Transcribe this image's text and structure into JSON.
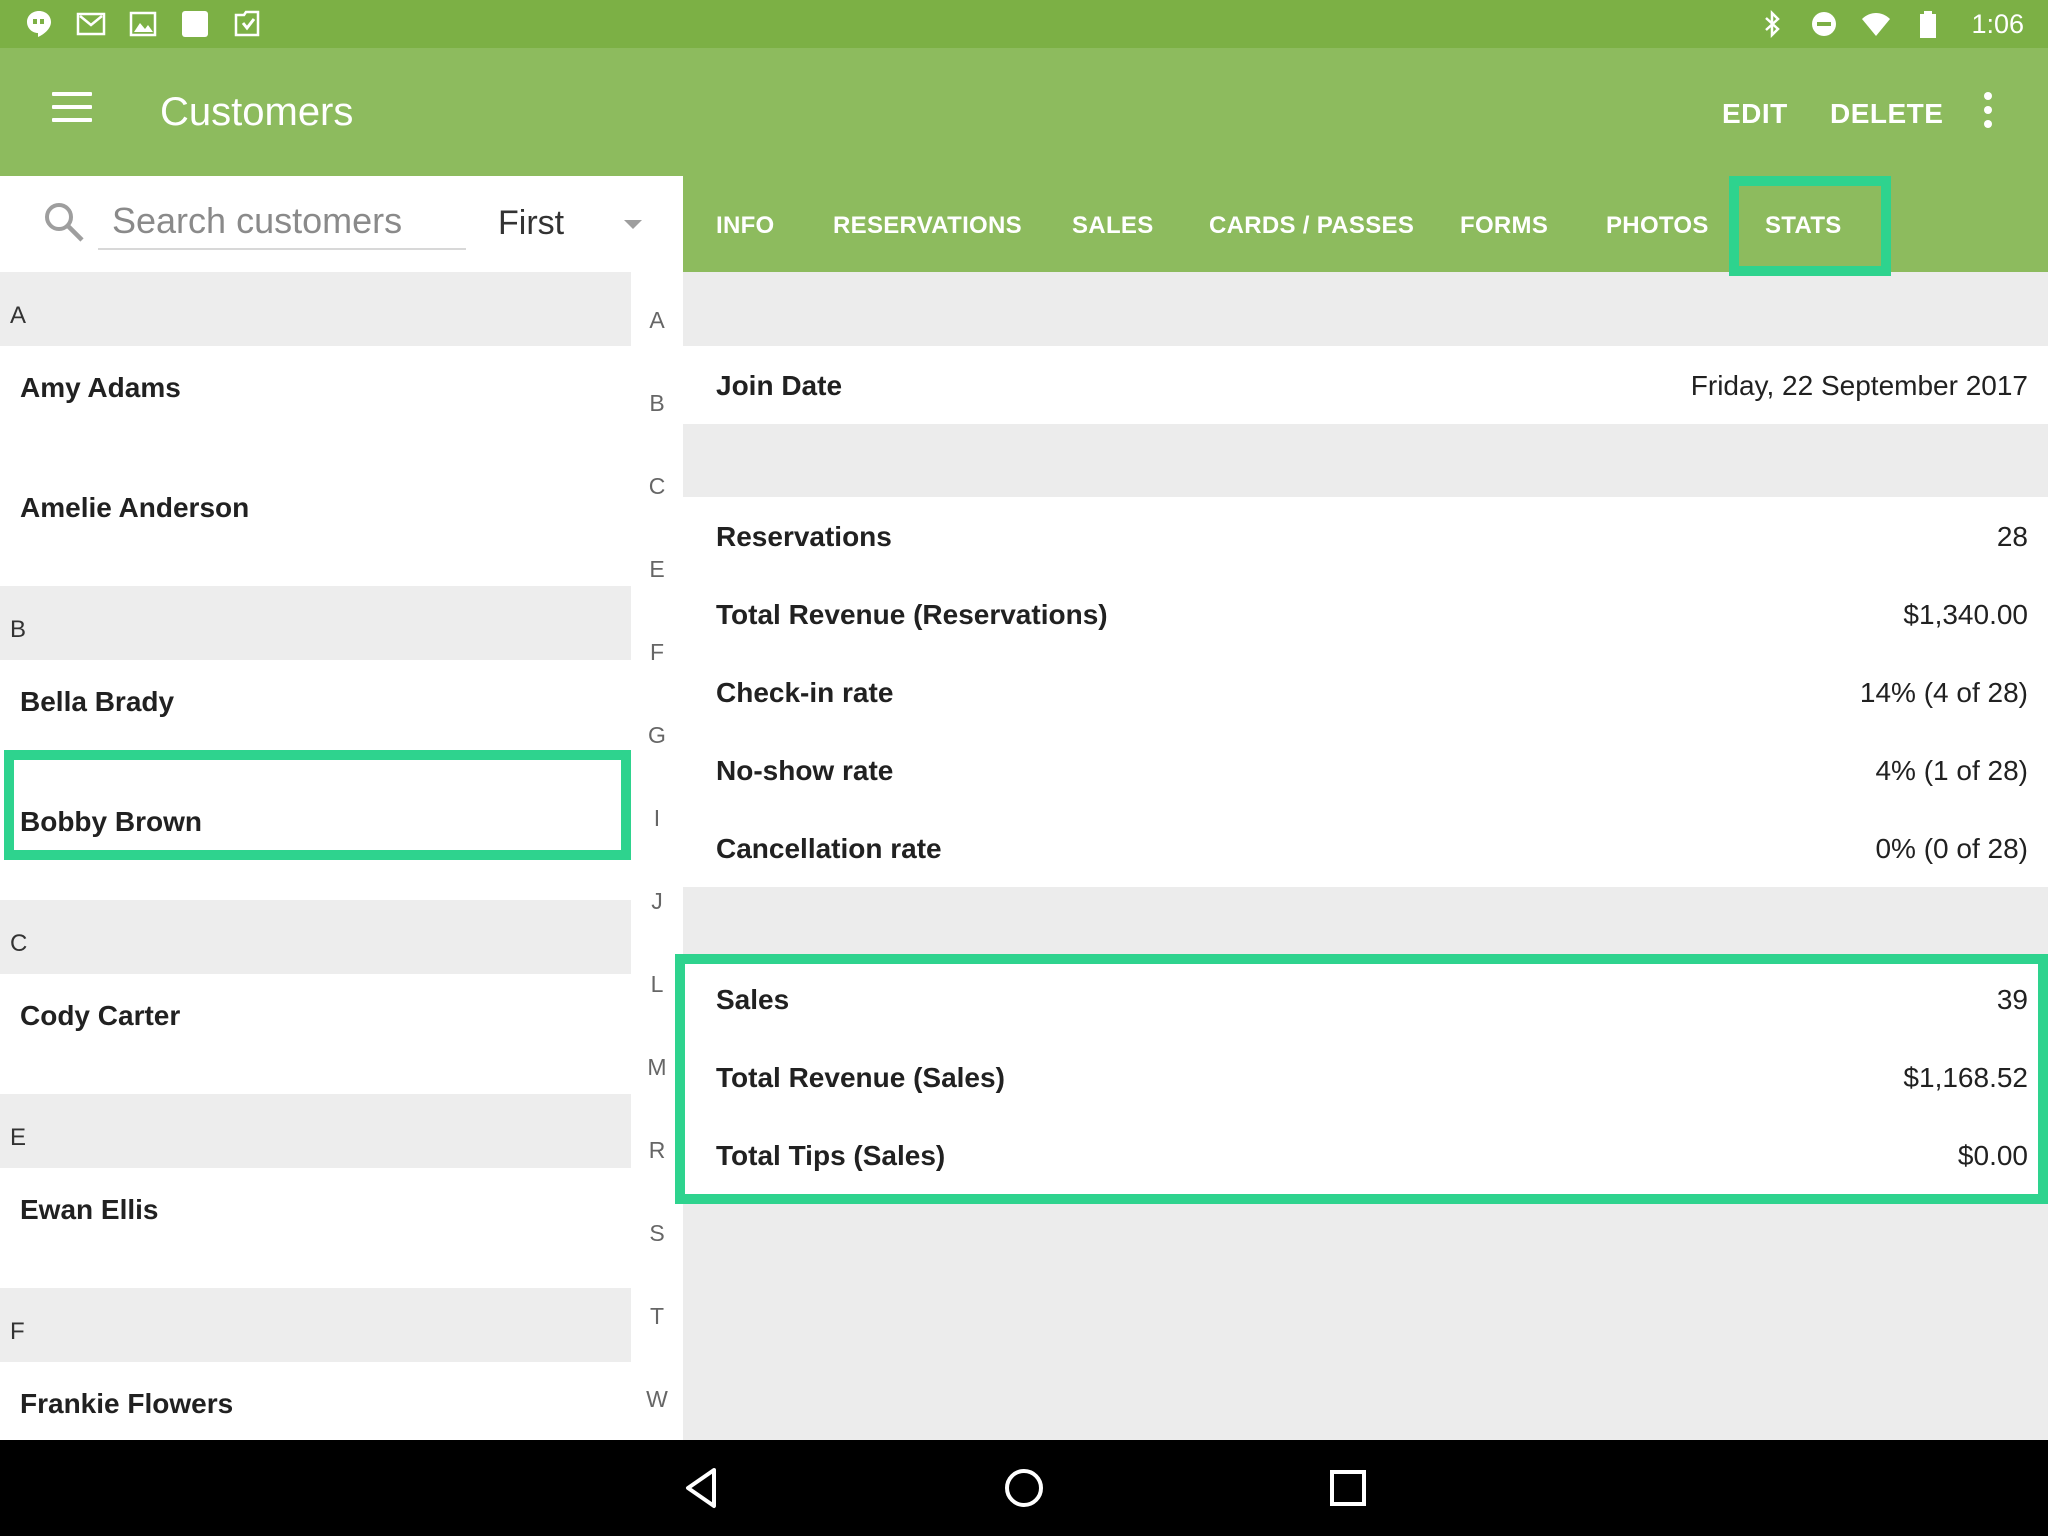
{
  "status_bar": {
    "time": "1:06",
    "left_icons": [
      "hangouts-icon",
      "gmail-icon",
      "gallery-icon",
      "square-app-icon",
      "play-store-icon"
    ],
    "right_icons": [
      "bluetooth-icon",
      "do-not-disturb-icon",
      "wifi-icon",
      "battery-icon"
    ]
  },
  "app_bar": {
    "title": "Customers",
    "edit_label": "EDIT",
    "delete_label": "DELETE"
  },
  "search": {
    "placeholder": "Search customers",
    "value": "",
    "sort_value": "First"
  },
  "customer_list": {
    "sections": [
      {
        "letter": "A",
        "customers": [
          "Amy Adams",
          "Amelie Anderson"
        ]
      },
      {
        "letter": "B",
        "customers": [
          "Bella Brady",
          "Bobby Brown"
        ]
      },
      {
        "letter": "C",
        "customers": [
          "Cody Carter"
        ]
      },
      {
        "letter": "E",
        "customers": [
          "Ewan Ellis"
        ]
      },
      {
        "letter": "F",
        "customers": [
          "Frankie Flowers"
        ]
      }
    ],
    "selected_customer": "Bella Brady"
  },
  "index_letters": [
    "A",
    "B",
    "C",
    "E",
    "F",
    "G",
    "I",
    "J",
    "L",
    "M",
    "R",
    "S",
    "T",
    "W"
  ],
  "tabs": [
    {
      "label": "INFO"
    },
    {
      "label": "RESERVATIONS"
    },
    {
      "label": "SALES"
    },
    {
      "label": "CARDS / PASSES"
    },
    {
      "label": "FORMS"
    },
    {
      "label": "PHOTOS"
    },
    {
      "label": "STATS"
    }
  ],
  "active_tab": "STATS",
  "stats": {
    "join": {
      "label": "Join Date",
      "value": "Friday, 22 September 2017"
    },
    "reservations": [
      {
        "label": "Reservations",
        "value": "28"
      },
      {
        "label": "Total Revenue (Reservations)",
        "value": "$1,340.00"
      },
      {
        "label": "Check-in rate",
        "value": "14% (4 of 28)"
      },
      {
        "label": "No-show rate",
        "value": "4% (1 of 28)"
      },
      {
        "label": "Cancellation rate",
        "value": "0% (0 of 28)"
      }
    ],
    "sales": [
      {
        "label": "Sales",
        "value": "39"
      },
      {
        "label": "Total Revenue (Sales)",
        "value": "$1,168.52"
      },
      {
        "label": "Total Tips (Sales)",
        "value": "$0.00"
      }
    ]
  },
  "colors": {
    "status_bar": "#7cb045",
    "app_bar": "#8dbb5e",
    "highlight": "#2ed38e",
    "section_bg": "#ededed"
  }
}
